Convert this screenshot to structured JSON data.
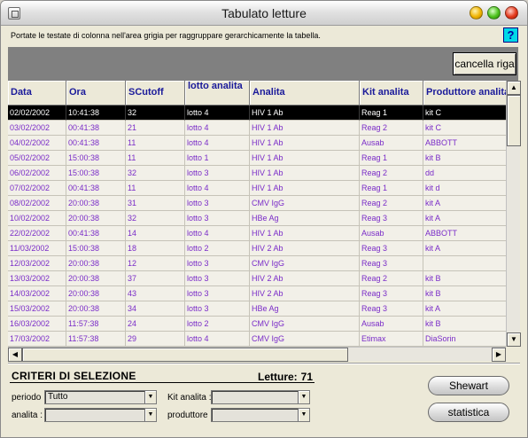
{
  "window": {
    "title": "Tabulato letture"
  },
  "instruction": "Portate le testate di colonna nell'area grigia per raggruppare gerarchicamente la tabella.",
  "help_label": "?",
  "toolbar": {
    "clear_row_label": "cancella riga"
  },
  "table": {
    "columns": [
      "Data",
      "Ora",
      "SCutoff",
      "lotto analita",
      "Analita",
      "Kit analita",
      "Produttore analita"
    ],
    "rows": [
      [
        "02/02/2002",
        "10:41:38",
        "32",
        "lotto 4",
        "HIV 1 Ab",
        "Reag 1",
        "kit C"
      ],
      [
        "03/02/2002",
        "00:41:38",
        "21",
        "lotto 4",
        "HIV 1 Ab",
        "Reag 2",
        "kit C"
      ],
      [
        "04/02/2002",
        "00:41:38",
        "11",
        "lotto 4",
        "HIV 1 Ab",
        "Ausab",
        "ABBOTT"
      ],
      [
        "05/02/2002",
        "15:00:38",
        "11",
        "lotto 1",
        "HIV 1 Ab",
        "Reag 1",
        "kit B"
      ],
      [
        "06/02/2002",
        "15:00:38",
        "32",
        "lotto 3",
        "HIV 1 Ab",
        "Reag 2",
        "dd"
      ],
      [
        "07/02/2002",
        "00:41:38",
        "11",
        "lotto 4",
        "HIV 1 Ab",
        "Reag 1",
        "kit d"
      ],
      [
        "08/02/2002",
        "20:00:38",
        "31",
        "lotto 3",
        "CMV IgG",
        "Reag 2",
        "kit A"
      ],
      [
        "10/02/2002",
        "20:00:38",
        "32",
        "lotto 3",
        "HBe Ag",
        "Reag 3",
        "kit A"
      ],
      [
        "22/02/2002",
        "00:41:38",
        "14",
        "lotto 4",
        "HIV 1 Ab",
        "Ausab",
        "ABBOTT"
      ],
      [
        "11/03/2002",
        "15:00:38",
        "18",
        "lotto 2",
        "HIV 2 Ab",
        "Reag 3",
        "kit A"
      ],
      [
        "12/03/2002",
        "20:00:38",
        "12",
        "lotto 3",
        "CMV IgG",
        "Reag 3",
        ""
      ],
      [
        "13/03/2002",
        "20:00:38",
        "37",
        "lotto 3",
        "HIV 2 Ab",
        "Reag 2",
        "kit B"
      ],
      [
        "14/03/2002",
        "20:00:38",
        "43",
        "lotto 3",
        "HIV 2 Ab",
        "Reag 3",
        "kit B"
      ],
      [
        "15/03/2002",
        "20:00:38",
        "34",
        "lotto 3",
        "HBe Ag",
        "Reag 3",
        "kit A"
      ],
      [
        "16/03/2002",
        "11:57:38",
        "24",
        "lotto 2",
        "CMV IgG",
        "Ausab",
        "kit B"
      ],
      [
        "17/03/2002",
        "11:57:38",
        "29",
        "lotto 4",
        "CMV IgG",
        "Etimax",
        "DiaSorin"
      ]
    ]
  },
  "criteria": {
    "title": "CRITERI DI SELEZIONE",
    "readings_label": "Letture:",
    "readings_count": "71",
    "period_label": "periodo :",
    "period_value": "Tutto",
    "analyte_label": "analita :",
    "analyte_value": "",
    "kit_label": "Kit analita :",
    "kit_value": "",
    "producer_label": "produttore :",
    "producer_value": ""
  },
  "buttons": {
    "shewart": "Shewart",
    "statistics": "statistica"
  },
  "colors": {
    "row_text": "#7a2cc8",
    "header_text": "#1a1a9a",
    "selected_bg": "#000000",
    "group_area": "#808080",
    "help_bg": "#00d8e8"
  }
}
